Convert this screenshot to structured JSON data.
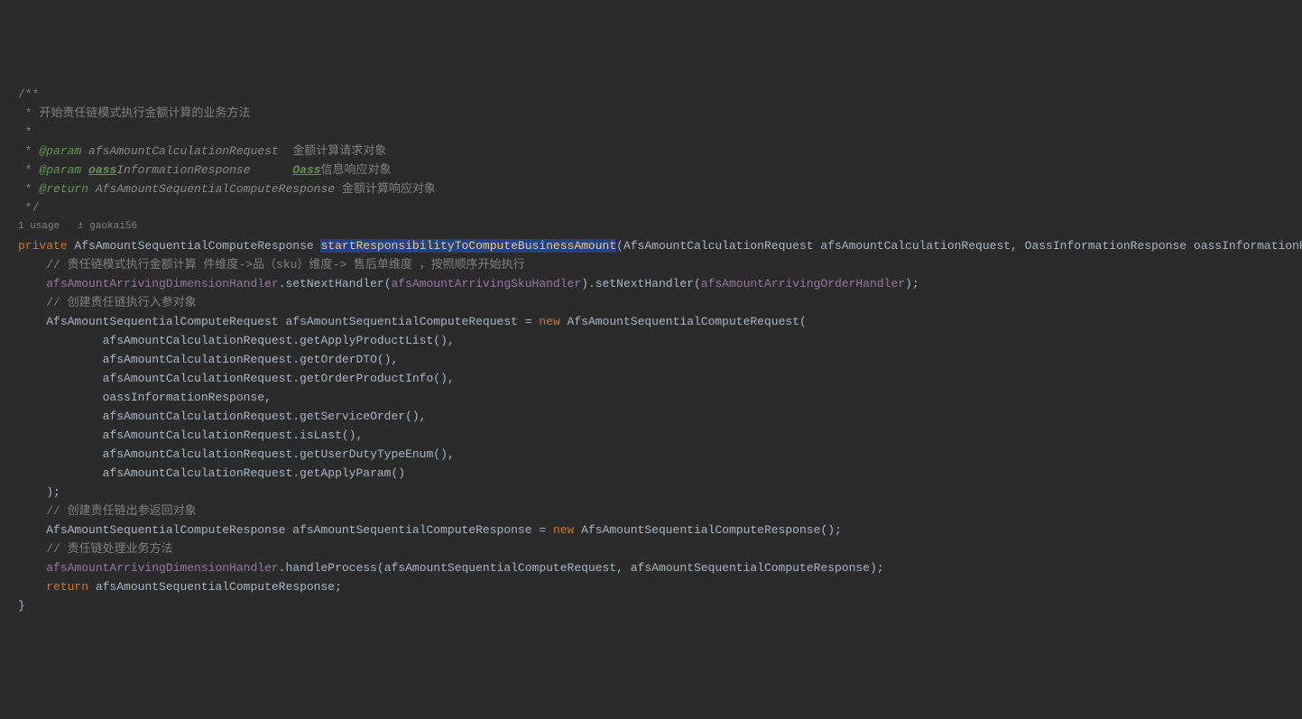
{
  "doc": {
    "open": "/**",
    "line1": " * 开始责任链模式执行金额计算的业务方法",
    "star": " *",
    "param_tag": " @param",
    "param1_name": "afsAmountCalculationRequest",
    "param1_desc": "  金额计算请求对象",
    "param2_name": "oassInformationResponse",
    "param2_name_part1": "oass",
    "param2_name_part2": "InformationResponse",
    "param2_spacer": "      ",
    "param2_desc_part1": "Oass",
    "param2_desc_part2": "信息响应对象",
    "return_tag": " @return",
    "return_type": " AfsAmountSequentialComputeResponse",
    "return_desc": " 金额计算响应对象",
    "close": " */"
  },
  "meta": {
    "usage": "1 usage",
    "author_icon": "👤",
    "author": "gaokai56"
  },
  "code": {
    "kw_private": "private",
    "ret_type": "AfsAmountSequentialComputeResponse",
    "method_name": "startResponsibilityToComputeBusinessAmount",
    "param1_type": "AfsAmountCalculationRequest",
    "param1_name": "afsAmountCalculationRequest",
    "param2_type": "OassInformationResponse",
    "param2_name": "oassInformationResponse",
    "c1": "// 责任链模式执行金额计算 件维度->品（sku）维度-> 售后单维度 ，按照顺序开始执行",
    "field1": "afsAmountArrivingDimensionHandler",
    "m_setNext": ".setNextHandler(",
    "field2": "afsAmountArrivingSkuHandler",
    "m_setNext2": ").setNextHandler(",
    "field3": "afsAmountArrivingOrderHandler",
    "close1": ");",
    "c2": "// 创建责任链执行入参对象",
    "req_type": "AfsAmountSequentialComputeRequest",
    "req_var": "afsAmountSequentialComputeRequest",
    "eq": " = ",
    "kw_new": "new",
    "req_ctor": " AfsAmountSequentialComputeRequest(",
    "arg1": "afsAmountCalculationRequest.getApplyProductList(),",
    "arg2": "afsAmountCalculationRequest.getOrderDTO(),",
    "arg3": "afsAmountCalculationRequest.getOrderProductInfo(),",
    "arg4": "oassInformationResponse,",
    "arg5": "afsAmountCalculationRequest.getServiceOrder(),",
    "arg6": "afsAmountCalculationRequest.isLast(),",
    "arg7": "afsAmountCalculationRequest.getUserDutyTypeEnum(),",
    "arg8": "afsAmountCalculationRequest.getApplyParam()",
    "close2": ");",
    "c3": "// 创建责任链出参返回对象",
    "resp_type": "AfsAmountSequentialComputeResponse",
    "resp_var": "afsAmountSequentialComputeResponse",
    "resp_ctor": " AfsAmountSequentialComputeResponse();",
    "c4": "// 责任链处理业务方法",
    "handler_call": ".handleProcess(afsAmountSequentialComputeRequest, afsAmountSequentialComputeResponse);",
    "kw_return": "return",
    "ret_stmt": " afsAmountSequentialComputeResponse;",
    "brace_close": "}"
  }
}
